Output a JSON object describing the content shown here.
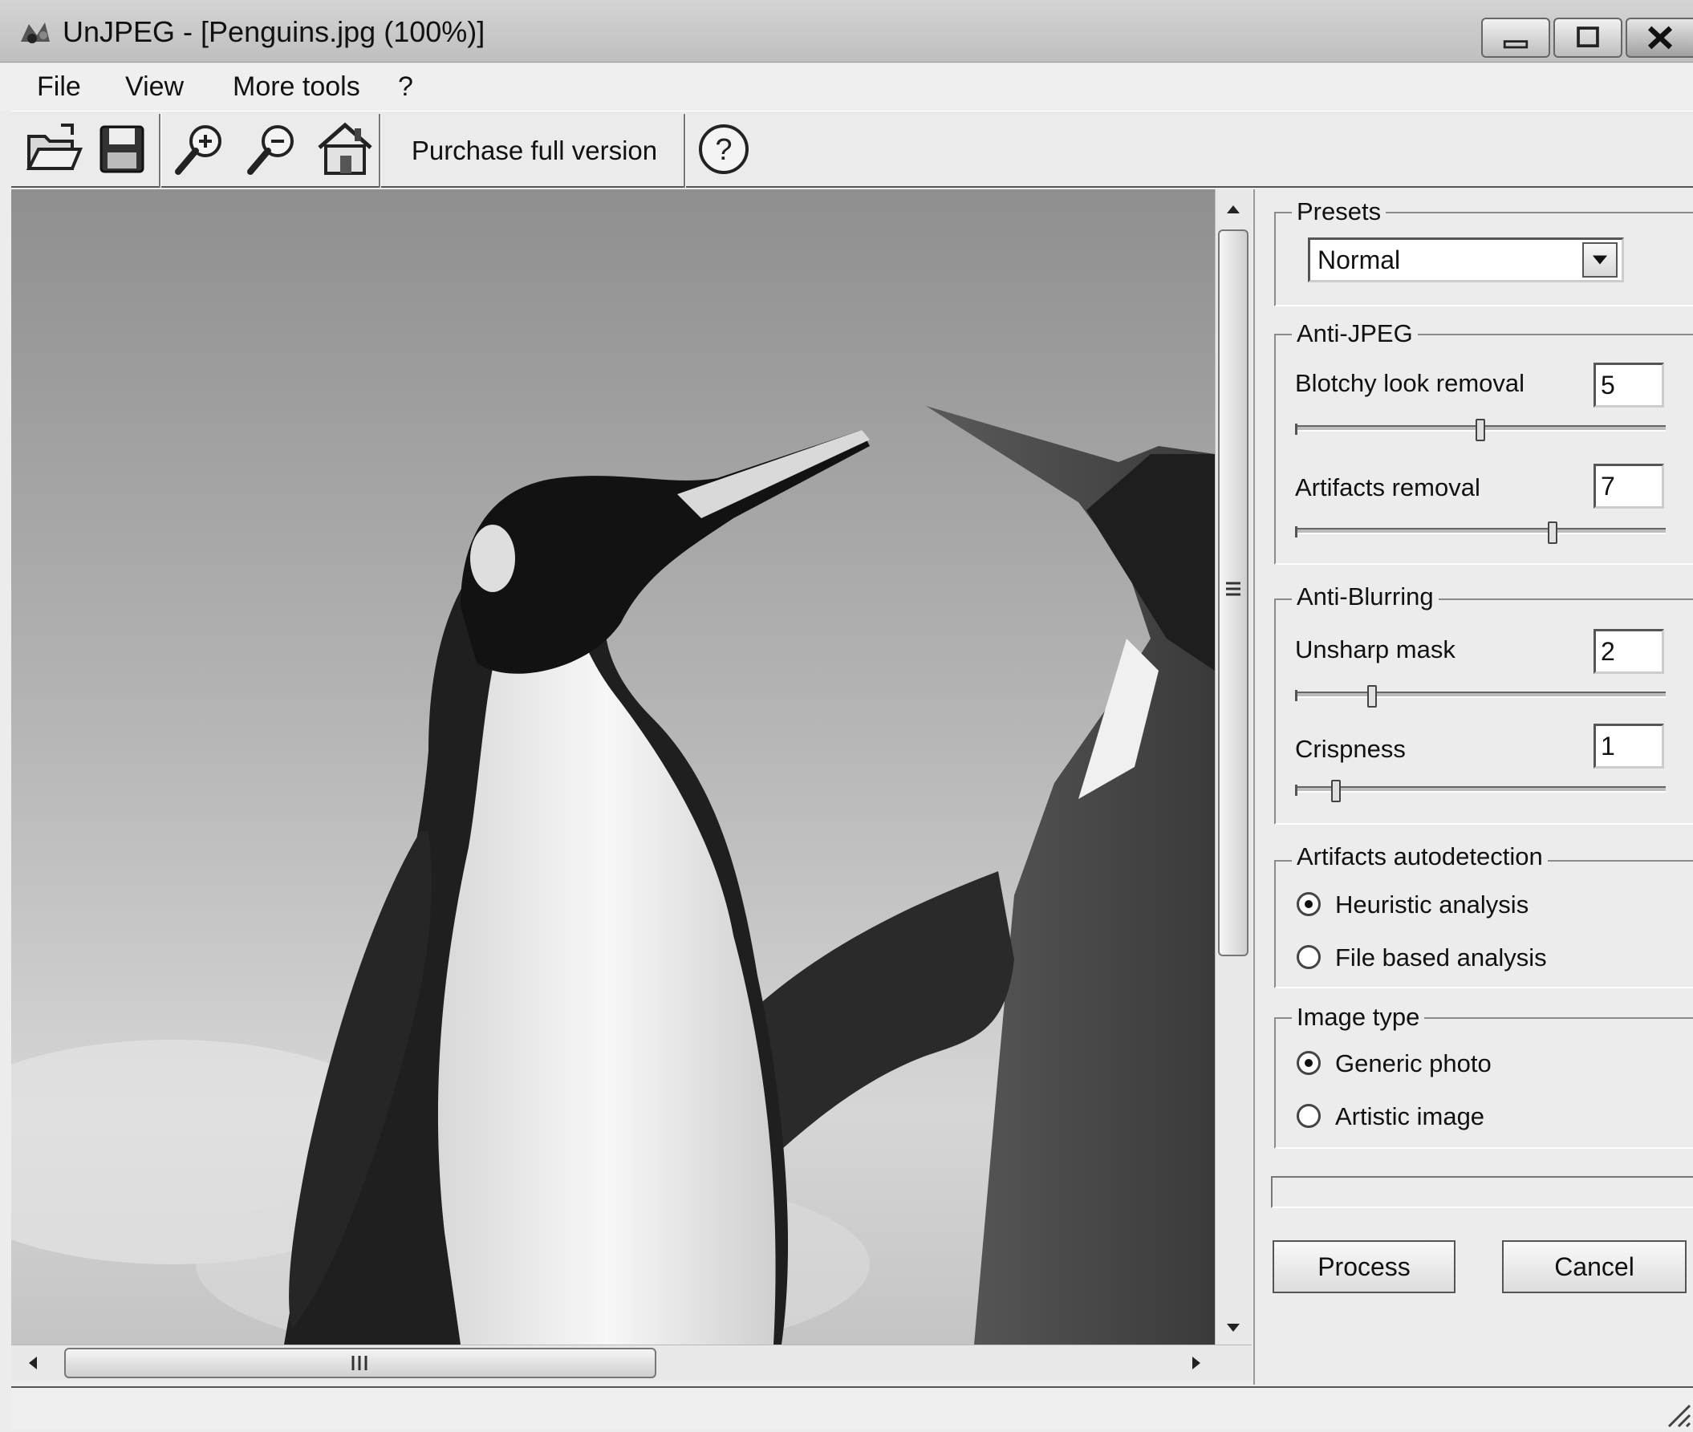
{
  "window": {
    "title": "UnJPEG - [Penguins.jpg (100%)]"
  },
  "menu": {
    "file": "File",
    "view": "View",
    "more_tools": "More tools",
    "help": "?"
  },
  "toolbar": {
    "icons": [
      "open-folder-icon",
      "save-disk-icon",
      "zoom-in-icon",
      "zoom-out-icon",
      "home-icon",
      "help-icon"
    ],
    "purchase_label": "Purchase full version"
  },
  "image": {
    "description_icon": "penguins-photo"
  },
  "panel": {
    "presets": {
      "label": "Presets",
      "selected": "Normal"
    },
    "anti_jpeg": {
      "label": "Anti-JPEG",
      "blotchy": {
        "label": "Blotchy look removal",
        "value": "5",
        "level": 0.5
      },
      "artifacts": {
        "label": "Artifacts removal",
        "value": "7",
        "level": 0.7
      }
    },
    "anti_blurring": {
      "label": "Anti-Blurring",
      "unsharp": {
        "label": "Unsharp mask",
        "value": "2",
        "level": 0.2
      },
      "crispness": {
        "label": "Crispness",
        "value": "1",
        "level": 0.1
      }
    },
    "autodetection": {
      "label": "Artifacts autodetection",
      "options": [
        {
          "label": "Heuristic analysis",
          "selected": true
        },
        {
          "label": "File based analysis",
          "selected": false
        }
      ]
    },
    "image_type": {
      "label": "Image type",
      "options": [
        {
          "label": "Generic photo",
          "selected": true
        },
        {
          "label": "Artistic image",
          "selected": false
        }
      ]
    },
    "process_label": "Process",
    "cancel_label": "Cancel"
  }
}
